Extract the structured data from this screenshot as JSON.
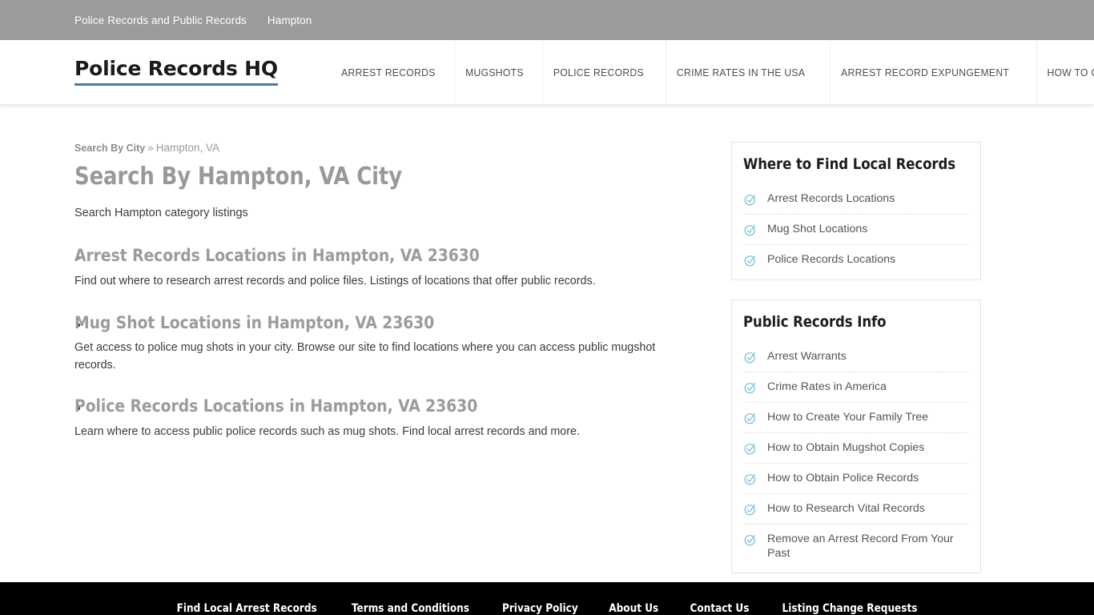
{
  "topbar": {
    "links": [
      {
        "label": "Police Records and Public Records"
      },
      {
        "label": "Hampton"
      }
    ]
  },
  "header": {
    "logo": "Police Records HQ",
    "accent_color": "#4a7ba8",
    "nav": [
      {
        "label": "ARREST RECORDS"
      },
      {
        "label": "MUGSHOTS"
      },
      {
        "label": "POLICE RECORDS"
      },
      {
        "label": "CRIME RATES IN THE USA"
      },
      {
        "label": "ARREST RECORD EXPUNGEMENT"
      },
      {
        "label": "HOW TO OBTAIN PUBLIC RECORDS"
      }
    ]
  },
  "breadcrumb": {
    "root": "Search By City",
    "separator": "»",
    "current": "Hampton, VA"
  },
  "main": {
    "title": "Search By Hampton, VA City",
    "intro": "Search Hampton category listings",
    "listings": [
      {
        "title": "Arrest Records Locations in Hampton, VA 23630",
        "desc": "Find out where to research arrest records and police files. Listings of locations that offer public records."
      },
      {
        "title": "Mug Shot Locations in Hampton, VA 23630",
        "desc": "Get access to police mug shots in your city. Browse our site to find locations where you can access public mugshot records."
      },
      {
        "title": "Police Records Locations in Hampton, VA 23630",
        "desc": "Learn where to access public police records such as mug shots. Find local arrest records and more."
      }
    ]
  },
  "sidebar": {
    "icon_color": "#7fc3d8",
    "widgets": [
      {
        "title": "Where to Find Local Records",
        "items": [
          {
            "label": "Arrest Records Locations",
            "icon": "circle-check-icon"
          },
          {
            "label": "Mug Shot Locations",
            "icon": "circle-check-icon"
          },
          {
            "label": "Police Records Locations",
            "icon": "circle-check-icon"
          }
        ]
      },
      {
        "title": "Public Records Info",
        "items": [
          {
            "label": "Arrest Warrants",
            "icon": "circle-check-icon"
          },
          {
            "label": "Crime Rates in America",
            "icon": "circle-check-icon"
          },
          {
            "label": "How to Create Your Family Tree",
            "icon": "circle-check-icon"
          },
          {
            "label": "How to Obtain Mugshot Copies",
            "icon": "circle-check-icon"
          },
          {
            "label": "How to Obtain Police Records",
            "icon": "circle-check-icon"
          },
          {
            "label": "How to Research Vital Records",
            "icon": "circle-check-icon"
          },
          {
            "label": "Remove an Arrest Record From Your Past",
            "icon": "circle-check-icon"
          }
        ]
      }
    ]
  },
  "footer": {
    "links": [
      {
        "label": "Find Local Arrest Records"
      },
      {
        "label": "Terms and Conditions"
      },
      {
        "label": "Privacy Policy"
      },
      {
        "label": "About Us"
      },
      {
        "label": "Contact Us"
      },
      {
        "label": "Listing Change Requests"
      }
    ]
  }
}
